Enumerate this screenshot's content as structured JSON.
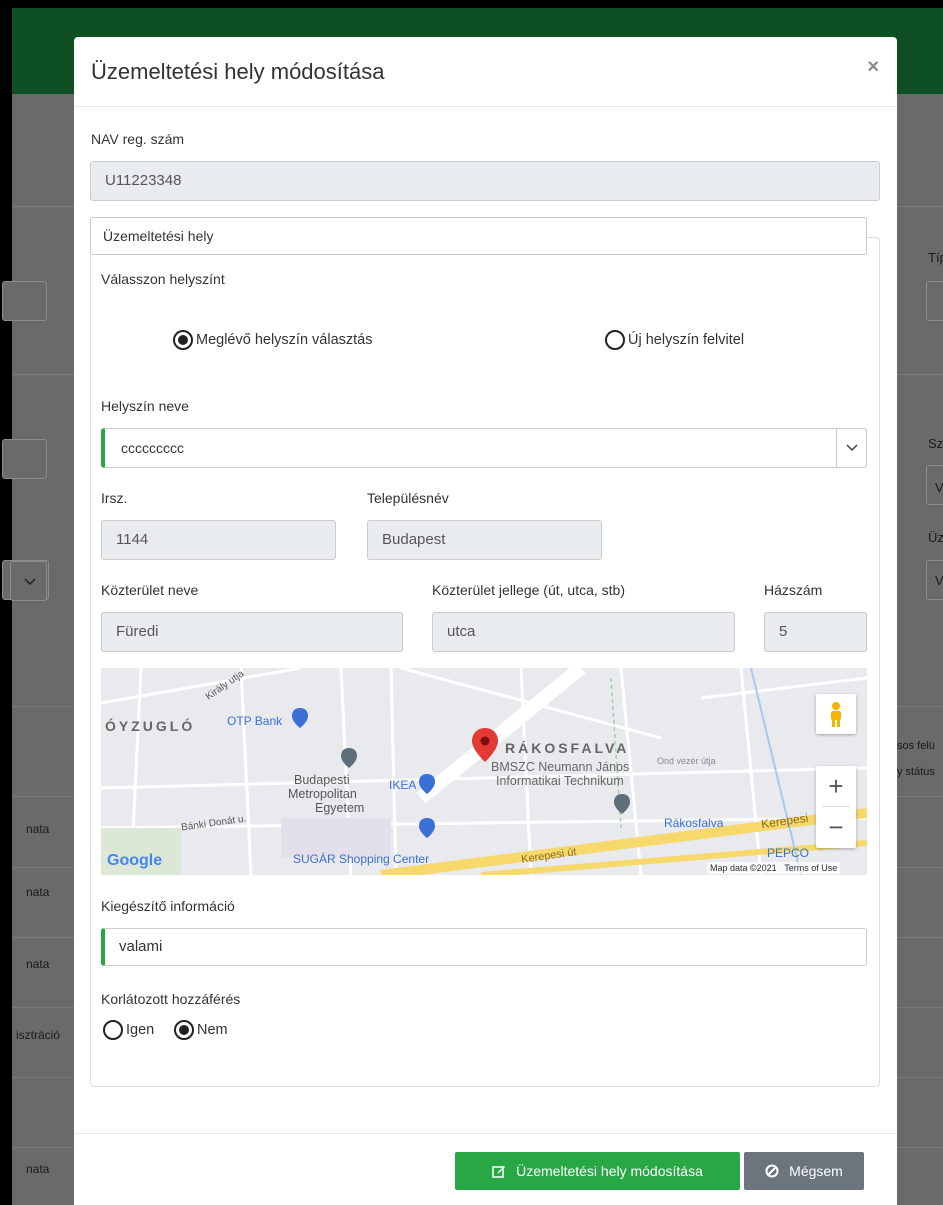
{
  "background": {
    "right_texts": [
      "Típ",
      "Sz",
      "V",
      "Üz",
      "V",
      "sos felü",
      "y státus"
    ],
    "left_texts": [
      "nata",
      "nata",
      "nata",
      "isztráció",
      "nata"
    ]
  },
  "modal": {
    "title": "Üzemeltetési hely módosítása",
    "close_label": "×",
    "nav_label": "NAV reg. szám",
    "nav_value": "U11223348",
    "section_title": "Üzemeltetési hely",
    "choose_label": "Válasszon helyszínt",
    "radio_existing": "Meglévő helyszín választás",
    "radio_new": "Új helyszín felvitel",
    "location_name_label": "Helyszín neve",
    "location_name_value": "ccccccccc",
    "zip_label": "Irsz.",
    "zip_value": "1144",
    "city_label": "Településnév",
    "city_value": "Budapest",
    "street_label": "Közterület neve",
    "street_value": "Füredi",
    "street_type_label": "Közterület jellege (út, utca, stb)",
    "street_type_value": "utca",
    "house_label": "Házszám",
    "house_value": "5",
    "extra_label": "Kiegészítő információ",
    "extra_value": "valami",
    "restricted_label": "Korlátozott hozzáférés",
    "radio_yes": "Igen",
    "radio_no": "Nem",
    "submit_label": "Üzemeltetési hely módosítása",
    "cancel_label": "Mégsem"
  },
  "map": {
    "labels": {
      "district1": "ÓYZUGLÓ",
      "district2": "RÁKOSFALVA",
      "otp": "OTP Bank",
      "school1": "BMSZC Neumann János",
      "school2": "Informatikai Technikum",
      "uni1": "Budapesti",
      "uni2": "Metropolitan",
      "uni3": "Egyetem",
      "ikea": "IKEA",
      "banki": "Bánki Donát u.",
      "sugar": "SUGÁR Shopping Center",
      "kerepesi": "Kerepesi út",
      "kerepesi2": "Kerepesi",
      "rakosfalva_station": "Rákosfalva",
      "pepco": "PEPCO",
      "google": "Google",
      "mapdata": "Map data ©2021",
      "terms": "Terms of Use",
      "kiraly": "Király utja",
      "zugloi": "Ond vezér útja"
    }
  }
}
